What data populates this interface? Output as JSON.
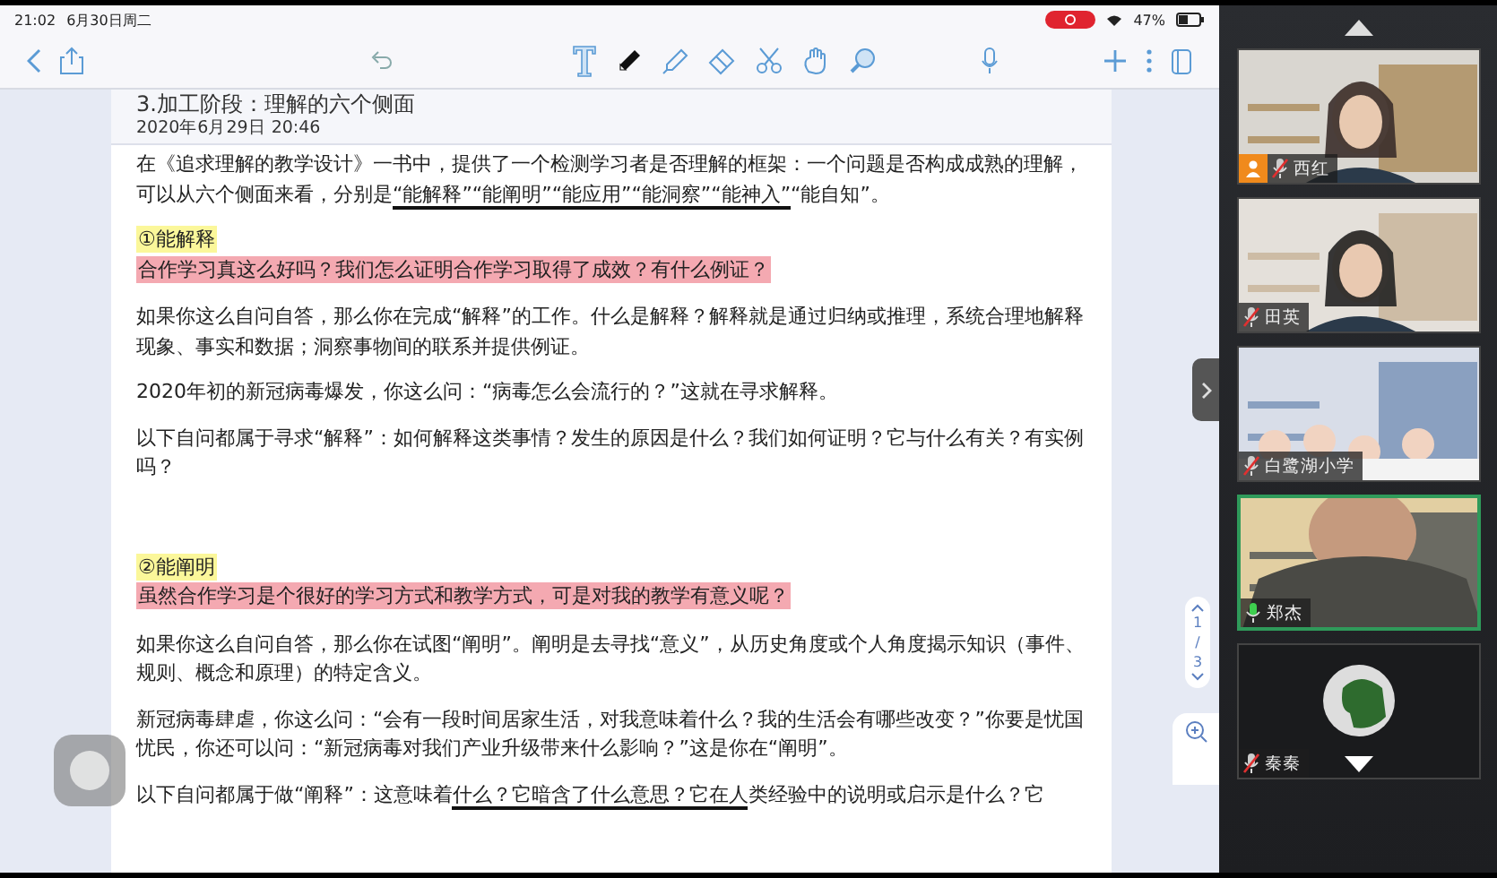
{
  "status_bar": {
    "time": "21:02",
    "date": "6月30日周二",
    "recording": true,
    "battery_text": "47%"
  },
  "note": {
    "title": "3.加工阶段：理解的六个侧面",
    "date": "2020年6月29日 20:46",
    "paragraphs": [
      {
        "kind": "body",
        "segments": [
          {
            "text": "在《追求理解的教学设计》一书中，提供了一个检测学习者是否理解的框架：一个问题是否构成成熟的理解，可以从六个侧面来看，分别是",
            "underlined": false
          },
          {
            "text": "“能解释”",
            "underlined": true
          },
          {
            "text": "“能阐明”",
            "underlined": true
          },
          {
            "text": "“能应用”",
            "underlined": true
          },
          {
            "text": "“能洞察”",
            "underlined": true
          },
          {
            "text": "“能神入”",
            "underlined": true
          },
          {
            "text": "“能自知”。",
            "underlined": false
          }
        ]
      },
      {
        "kind": "heading",
        "text": "①能解释"
      },
      {
        "kind": "question",
        "text": "合作学习真这么好吗？我们怎么证明合作学习取得了成效？有什么例证？"
      },
      {
        "kind": "body",
        "text": "如果你这么自问自答，那么你在完成“解释”的工作。什么是解释？解释就是通过归纳或推理，系统合理地解释现象、事实和数据；洞察事物间的联系并提供例证。"
      },
      {
        "kind": "body",
        "text": "2020年初的新冠病毒爆发，你这么问：“病毒怎么会流行的？”这就在寻求解释。"
      },
      {
        "kind": "body",
        "text": "以下自问都属于寻求“解释”：如何解释这类事情？发生的原因是什么？我们如何证明？它与什么有关？有实例吗？"
      },
      {
        "kind": "spacer"
      },
      {
        "kind": "heading",
        "text": "②能阐明"
      },
      {
        "kind": "question",
        "text": "虽然合作学习是个很好的学习方式和教学方式，可是对我的教学有意义呢？"
      },
      {
        "kind": "body",
        "text": "如果你这么自问自答，那么你在试图“阐明”。阐明是去寻找“意义”，从历史角度或个人角度揭示知识（事件、规则、概念和原理）的特定含义。"
      },
      {
        "kind": "body",
        "text": "新冠病毒肆虐，你这么问：“会有一段时间居家生活，对我意味着什么？我的生活会有哪些改变？”你要是忧国忧民，你还可以问：“新冠病毒对我们产业升级带来什么影响？”这是你在“阐明”。"
      },
      {
        "kind": "body",
        "segments": [
          {
            "text": "以下自问都属于做“阐释”：这意味着",
            "underlined": false
          },
          {
            "text": "什么？它暗含了什么意思？它在人",
            "underlined": true
          },
          {
            "text": "类经验中的说明或启示是什么？它",
            "underlined": false
          }
        ]
      }
    ]
  },
  "pager": {
    "current": "1",
    "separator": "/",
    "total": "3"
  },
  "participants": [
    {
      "name": "西红",
      "muted": true,
      "host": true,
      "speaking": false,
      "kind": "video"
    },
    {
      "name": "田英",
      "muted": true,
      "host": false,
      "speaking": false,
      "kind": "video"
    },
    {
      "name": "白鹭湖小学",
      "muted": true,
      "host": false,
      "speaking": false,
      "kind": "video"
    },
    {
      "name": "郑杰",
      "muted": false,
      "host": false,
      "speaking": true,
      "kind": "video"
    },
    {
      "name": "秦秦",
      "muted": true,
      "host": false,
      "speaking": false,
      "kind": "avatar"
    }
  ]
}
